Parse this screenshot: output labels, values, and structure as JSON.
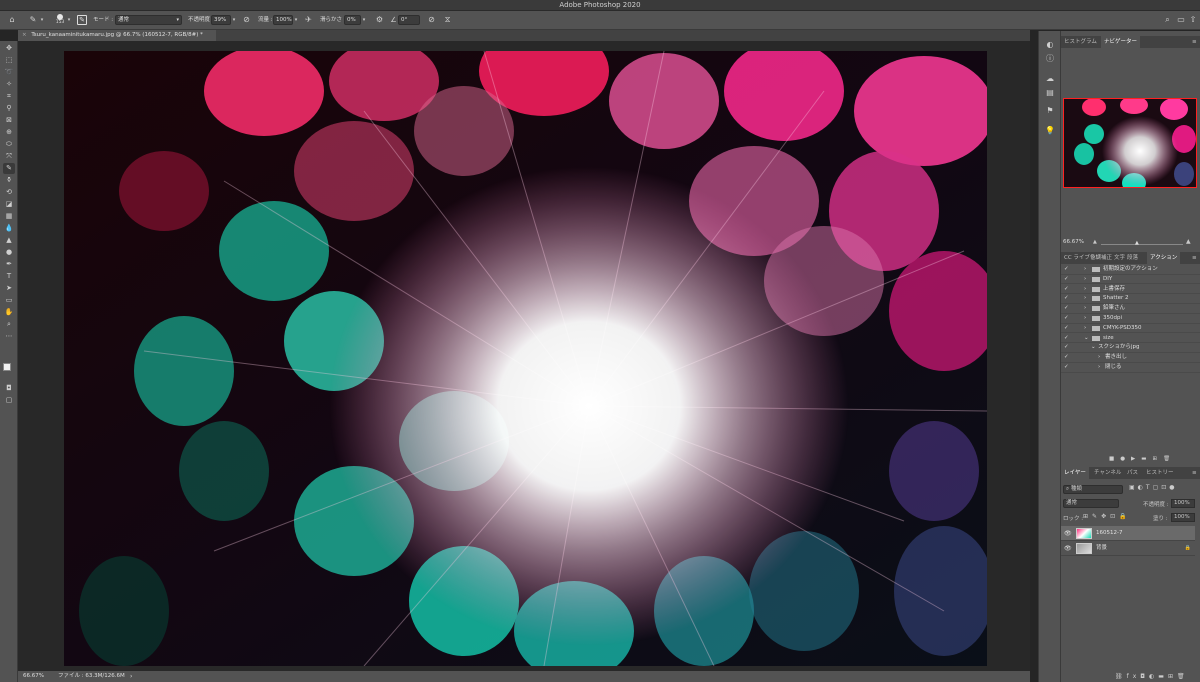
{
  "window": {
    "title": "Adobe Photoshop 2020"
  },
  "options_bar": {
    "brush_size": "153",
    "mode_label": "モード :",
    "mode_value": "通常",
    "opacity_label": "不透明度 :",
    "opacity_value": "39%",
    "flow_label": "流量 :",
    "flow_value": "100%",
    "smoothing_label": "滑らかさ :",
    "smoothing_value": "0%",
    "angle_value": "0°"
  },
  "document": {
    "tab_title": "Tsuru_kanaaminitukamaru.jpg @ 66.7% (160512-7, RGB/8#) *"
  },
  "status": {
    "zoom": "66.67%",
    "file_info": "ファイル : 63.3M/126.6M"
  },
  "navigator": {
    "tabs": [
      "ヒストグラム",
      "ナビゲーター"
    ],
    "zoom": "66.67%"
  },
  "actions_panel": {
    "tabs": [
      "CC ライブラリ",
      "色調補正",
      "文字",
      "段落",
      "アクション"
    ],
    "items": [
      {
        "label": "初期設定のアクション",
        "level": 0
      },
      {
        "label": "DIY",
        "level": 0
      },
      {
        "label": "上書保存",
        "level": 0
      },
      {
        "label": "Shatter 2",
        "level": 0
      },
      {
        "label": "鉛筆さん",
        "level": 0
      },
      {
        "label": "350dpi",
        "level": 0
      },
      {
        "label": "CMYK-PSD350",
        "level": 0
      },
      {
        "label": "size",
        "level": 0
      },
      {
        "label": "スクショからjpg",
        "level": 1
      },
      {
        "label": "書き出し",
        "level": 2
      },
      {
        "label": "閉じる",
        "level": 2
      }
    ]
  },
  "layers_panel": {
    "tabs": [
      "レイヤー",
      "チャンネル",
      "パス",
      "ヒストリー"
    ],
    "kind_filter": "種類",
    "blend_mode": "通常",
    "opacity_label": "不透明度 :",
    "opacity_value": "100%",
    "lock_label": "ロック :",
    "fill_label": "塗り :",
    "fill_value": "100%",
    "layers": [
      {
        "name": "160512-7",
        "selected": true
      },
      {
        "name": "背景",
        "selected": false,
        "locked": true
      }
    ]
  },
  "colors": {
    "accent_pink": "#ff2f7e",
    "accent_teal": "#17d8b4",
    "navigator_frame": "#ff2020"
  }
}
